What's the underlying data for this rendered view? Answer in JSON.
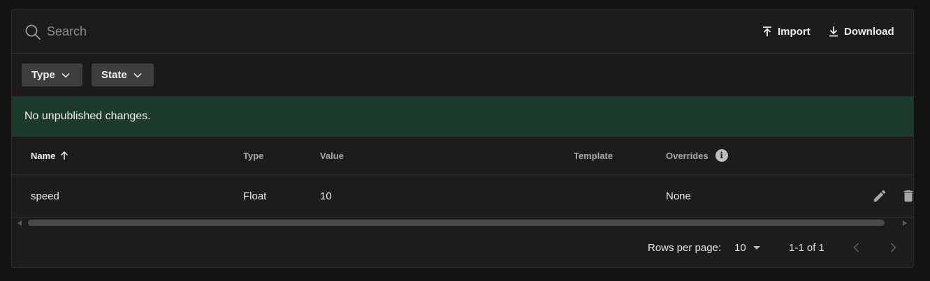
{
  "search": {
    "placeholder": "Search",
    "value": ""
  },
  "actions": {
    "import_label": "Import",
    "download_label": "Download"
  },
  "filters": [
    {
      "label": "Type"
    },
    {
      "label": "State"
    }
  ],
  "banner": {
    "text": "No unpublished changes.",
    "color": "#1c3b2b"
  },
  "table": {
    "columns": {
      "name": "Name",
      "type": "Type",
      "value": "Value",
      "template": "Template",
      "overrides": "Overrides"
    },
    "sort": {
      "column": "Name",
      "direction": "ascending"
    },
    "rows": [
      {
        "name": "speed",
        "type": "Float",
        "value": "10",
        "template": "",
        "overrides": "None"
      }
    ]
  },
  "pagination": {
    "rows_per_page_label": "Rows per page:",
    "rows_per_page": "10",
    "range": "1-1 of 1"
  },
  "icons": {
    "search": "search-icon",
    "import": "upload-icon",
    "download": "download-icon",
    "chevron": "chevron-down-icon",
    "sort": "arrow-up-icon",
    "info": "info-icon",
    "edit": "pencil-icon",
    "delete": "trash-icon",
    "prev": "chevron-left-icon",
    "next": "chevron-right-icon"
  }
}
